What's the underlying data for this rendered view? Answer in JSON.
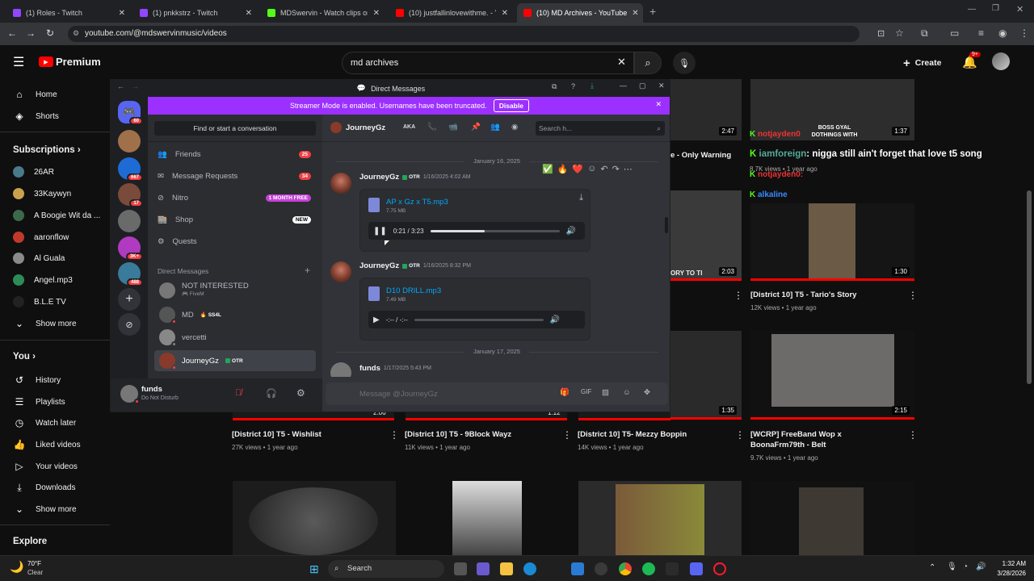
{
  "browser": {
    "tabs": [
      {
        "label": "(1) Roles - Twitch",
        "color": "#9146ff"
      },
      {
        "label": "(1) pnkkstrz - Twitch",
        "color": "#9146ff"
      },
      {
        "label": "MDSwervin - Watch clips on Ki",
        "color": "#53fc18"
      },
      {
        "label": "(10) justfallinlovewithme. - You",
        "color": "#ff0000"
      },
      {
        "label": "(10) MD Archives - YouTube",
        "color": "#ff0000"
      }
    ],
    "url": "youtube.com/@mdswervinmusic/videos"
  },
  "youtube": {
    "logo_text": "Premium",
    "search_value": "md archives",
    "create_label": "Create",
    "notif_badge": "9+",
    "sidebar": {
      "main": [
        "Home",
        "Shorts"
      ],
      "subscriptions_label": "Subscriptions",
      "subscriptions": [
        "26AR",
        "33Kaywyn",
        "A Boogie Wit da ...",
        "aaronflow",
        "Al Guala",
        "Angel.mp3",
        "B.L.E TV"
      ],
      "show_more": "Show more",
      "you_label": "You",
      "you_items": [
        "History",
        "Playlists",
        "Watch later",
        "Liked videos",
        "Your videos",
        "Downloads"
      ],
      "show_more_2": "Show more",
      "explore_label": "Explore"
    },
    "videos_right": [
      {
        "dur": "2:47"
      },
      {
        "title": "e - Only Warning"
      },
      {
        "dur": "1:37"
      },
      {
        "title": "[District 10] T5 - Tario's Story",
        "meta": "12K views • 1 year ago",
        "dur": "1:30"
      },
      {
        "dur": "2:03",
        "overlay": "ORY TO TI"
      }
    ],
    "row3": [
      {
        "title": "[District 10] T5 - Wishlist",
        "meta": "27K views • 1 year ago",
        "dur": "2:06"
      },
      {
        "title": "[District 10] T5 - 9Block Wayz",
        "meta": "11K views • 1 year ago",
        "dur": "1:12"
      },
      {
        "title": "[District 10] T5- Mezzy Boppin",
        "meta": "14K views • 1 year ago",
        "dur": "1:35"
      },
      {
        "title": "[WCRP] FreeBand Wop x BoonaFrm79th - Belt",
        "meta": "9.7K views • 1 year ago",
        "dur": "2:15"
      }
    ],
    "row2_meta": "8.7K views • 1 year ago",
    "chat_overlay": [
      {
        "user": "notjayden0",
        "text": "BOSS GYAL DOTHINGS WITH"
      },
      {
        "user": "iamforeign",
        "text": "nigga still ain't forget that love t5 song"
      },
      {
        "user": "notjayden0:",
        "text": ""
      },
      {
        "user": "alkaline",
        "text": ""
      }
    ]
  },
  "discord": {
    "window_title": "Direct Messages",
    "banner_text": "Streamer Mode is enabled. Usernames have been truncated.",
    "banner_button": "Disable",
    "guild_badges": [
      "60",
      "667",
      "17",
      "3K+",
      "488"
    ],
    "find_conv": "Find or start a conversation",
    "nav": [
      {
        "label": "Friends",
        "badge": "25"
      },
      {
        "label": "Message Requests",
        "badge": "34"
      },
      {
        "label": "Nitro",
        "badge": "1 MONTH FREE"
      },
      {
        "label": "Shop",
        "badge": "NEW"
      },
      {
        "label": "Quests",
        "badge": ""
      }
    ],
    "dm_header": "Direct Messages",
    "dms": [
      {
        "name": "NOT INTERESTED",
        "sub": "FiveM"
      },
      {
        "name": "MD",
        "tag": "SS4L"
      },
      {
        "name": "vercetti"
      },
      {
        "name": "JourneyGz",
        "tag": "OTR"
      }
    ],
    "user_panel": {
      "name": "funds",
      "status": "Do Not Disturb"
    },
    "chat_header": {
      "name": "JourneyGz",
      "aka": "AKA",
      "search_placeholder": "Search h..."
    },
    "messages": [
      {
        "date": "January 16, 2025",
        "author": "JourneyGz",
        "tag": "OTR",
        "time": "1/16/2025 4:02 AM",
        "file": "AP x Gz x T5.mp3",
        "size": "7.75 MB",
        "player_time": "0:21 / 3:23",
        "progress": 0.42
      },
      {
        "author": "JourneyGz",
        "tag": "OTR",
        "time": "1/16/2025 8:32 PM",
        "file": "D10 DRILL.mp3",
        "size": "7.49 MB",
        "player_time": "-:-- / -:--",
        "progress": 0.0
      },
      {
        "date": "January 17, 2025",
        "author": "funds",
        "time": "1/17/2025 5:43 PM"
      }
    ],
    "reactions": [
      "✅",
      "🔥",
      "❤️"
    ],
    "composer_placeholder": "Message @JourneyGz"
  },
  "taskbar": {
    "weather_temp": "70°F",
    "weather_desc": "Clear",
    "search_label": "Search",
    "time": "1:32 AM",
    "date": "3/28/2026"
  }
}
